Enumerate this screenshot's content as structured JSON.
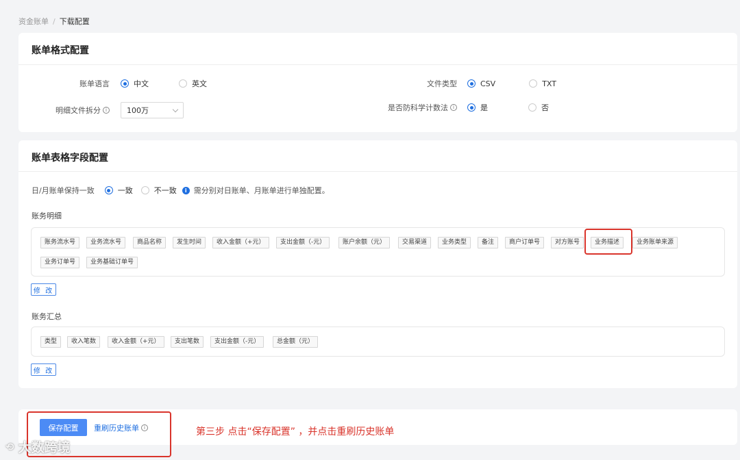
{
  "breadcrumb": {
    "parent": "资金账单",
    "separator": "/",
    "current": "下载配置"
  },
  "format_section": {
    "title": "账单格式配置",
    "language": {
      "label": "账单语言",
      "options": [
        "中文",
        "英文"
      ],
      "selected": "中文"
    },
    "file_type": {
      "label": "文件类型",
      "options": [
        "CSV",
        "TXT"
      ],
      "selected": "CSV"
    },
    "split": {
      "label": "明细文件拆分",
      "value": "100万"
    },
    "anti_sci": {
      "label": "是否防科学计数法",
      "options": [
        "是",
        "否"
      ],
      "selected": "是"
    }
  },
  "fields_section": {
    "title": "账单表格字段配置",
    "consistency": {
      "label": "日/月账单保持一致",
      "options": [
        "一致",
        "不一致"
      ],
      "selected": "一致",
      "hint": "需分别对日账单、月账单进行单独配置。"
    },
    "detail": {
      "label": "账务明细",
      "tags": [
        "账务流水号",
        "业务流水号",
        "商品名称",
        "发生时间",
        "收入金额（+元）",
        "支出金额（-元）",
        "账户余额（元）",
        "交易渠道",
        "业务类型",
        "备注",
        "商户订单号",
        "对方账号",
        "业务描述",
        "业务账单来源",
        "业务订单号",
        "业务基础订单号"
      ],
      "edit_label": "修 改"
    },
    "summary": {
      "label": "账务汇总",
      "tags": [
        "类型",
        "收入笔数",
        "收入金额（+元）",
        "支出笔数",
        "支出金额（-元）",
        "总金额（元）"
      ],
      "edit_label": "修 改"
    }
  },
  "footer": {
    "save_label": "保存配置",
    "history_label": "重刷历史账单",
    "annotation": "第三步 点击“保存配置” ，并点击重刷历史账单"
  },
  "watermark": {
    "text": "大数跨境",
    "logo": "⟲"
  },
  "colors": {
    "primary": "#1f6fe0",
    "highlight": "#d9342b",
    "save_button": "#4c8bf5"
  }
}
